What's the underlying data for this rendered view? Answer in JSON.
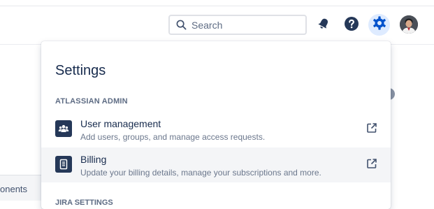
{
  "topnav": {
    "search_placeholder": "Search",
    "icons": [
      "search-icon",
      "notifications-bell-icon",
      "help-icon",
      "settings-gear-icon"
    ]
  },
  "background": {
    "partial_text": "onents"
  },
  "settings_menu": {
    "title": "Settings",
    "sections": [
      {
        "heading": "ATLASSIAN ADMIN",
        "items": [
          {
            "label": "User management",
            "description": "Add users, groups, and manage access requests.",
            "icon": "users-icon",
            "trailing_icon": "external-link-icon"
          },
          {
            "label": "Billing",
            "description": "Update your billing details, manage your subscriptions and more.",
            "icon": "billing-icon",
            "trailing_icon": "external-link-icon"
          }
        ]
      },
      {
        "heading": "JIRA SETTINGS"
      }
    ]
  },
  "colors": {
    "accent": "#0052cc",
    "selected_bg": "#deebff",
    "icon_tile": "#253858",
    "hover_row": "#f4f5f7"
  }
}
